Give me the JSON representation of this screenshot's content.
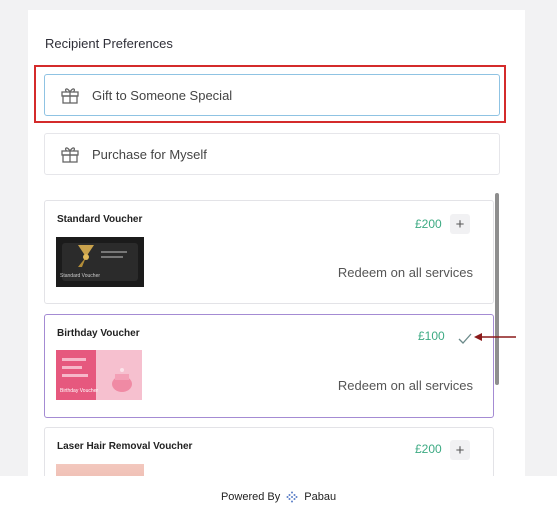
{
  "section": {
    "title": "Recipient Preferences"
  },
  "options": [
    {
      "label": "Gift to Someone Special",
      "icon": "gift-icon",
      "selected": true
    },
    {
      "label": "Purchase for Myself",
      "icon": "gift-icon",
      "selected": false
    }
  ],
  "vouchers": [
    {
      "name": "Standard Voucher",
      "price": "£200",
      "redeem": "Redeem on all services",
      "action": "add",
      "thumb_text": "Standard Voucher"
    },
    {
      "name": "Birthday Voucher",
      "price": "£100",
      "redeem": "Redeem on all services",
      "action": "selected",
      "thumb_text": "Birthday Voucher"
    },
    {
      "name": "Laser Hair Removal Voucher",
      "price": "£200",
      "redeem": "",
      "action": "add"
    }
  ],
  "footer": {
    "powered_by": "Powered By",
    "brand": "Pabau"
  },
  "colors": {
    "price": "#3daa83",
    "highlight": "#d42b2b",
    "selected_border": "#a48bd3",
    "arrow": "#8b1a1a"
  }
}
